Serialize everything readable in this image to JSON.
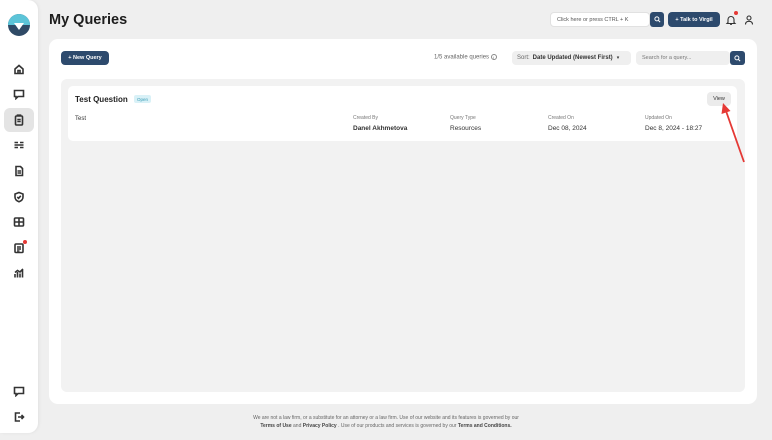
{
  "page": {
    "title": "My Queries"
  },
  "header": {
    "search_placeholder": "Click here or press CTRL + K",
    "talk_button": "+ Talk to Virgil"
  },
  "toolbar": {
    "new_query": "+ New Query",
    "available": "1/5 available queries",
    "sort_label": "Sort:",
    "sort_value": "Date Updated (Newest First)",
    "search_placeholder": "Search for a query..."
  },
  "queries": [
    {
      "title": "Test Question",
      "badge": "Open",
      "description": "Test",
      "created_by_label": "Created By",
      "created_by": "Danel Akhmetova",
      "query_type_label": "Query Type",
      "query_type": "Resources",
      "created_on_label": "Created On",
      "created_on": "Dec 08, 2024",
      "updated_on_label": "Updated On",
      "updated_on": "Dec 8, 2024 - 18:27",
      "view_label": "View"
    }
  ],
  "footer": {
    "line1": "We are not a law firm, or a substitute for an attorney or a law firm. Use of our website and its features is governed by our",
    "terms_of_use": "Terms of Use",
    "and": "and",
    "privacy": "Privacy Policy",
    "line2": ". Use of our products and services is governed by our",
    "terms_conditions": "Terms and Conditions."
  },
  "colors": {
    "primary": "#2d4a6d",
    "accent": "#5cc4d8",
    "alert": "#e53935"
  },
  "icons": [
    "home-icon",
    "chat-icon",
    "clipboard-icon",
    "list-icon",
    "document-icon",
    "shield-icon",
    "grid-icon",
    "report-icon",
    "analytics-icon",
    "chat-bottom-icon",
    "logout-icon",
    "search-icon",
    "bell-icon",
    "user-icon",
    "info-icon",
    "chevron-down-icon"
  ]
}
